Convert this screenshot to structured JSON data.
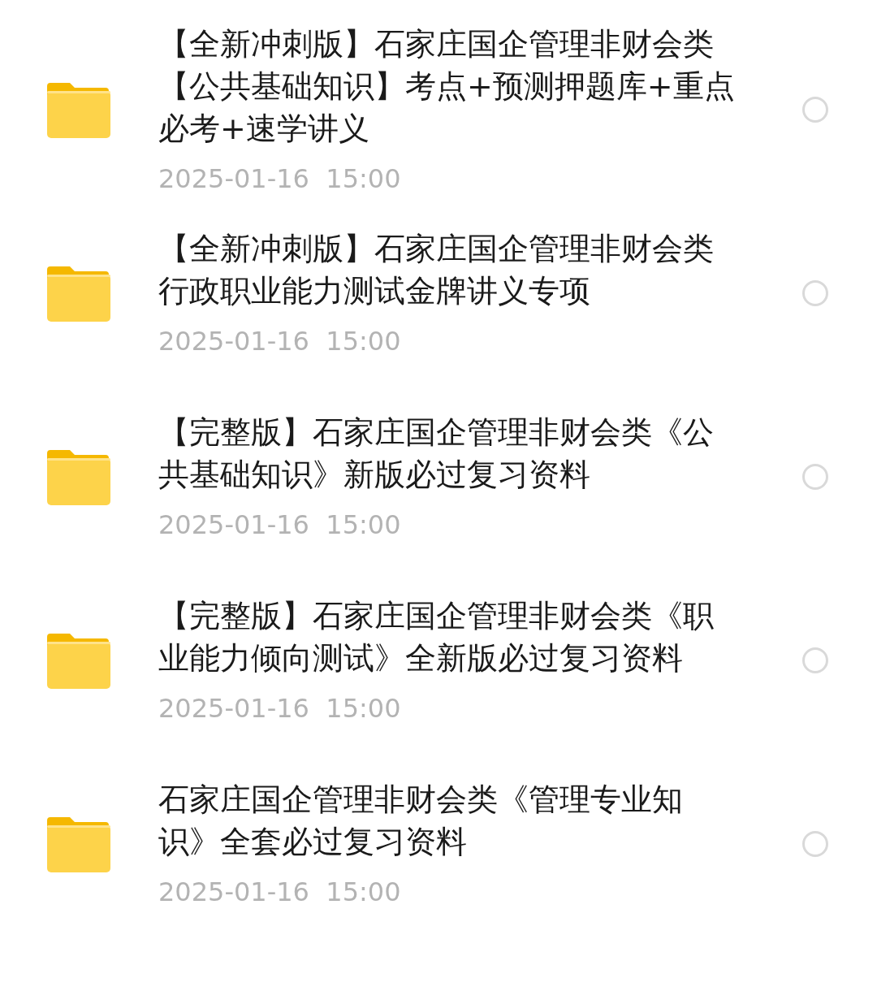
{
  "files": [
    {
      "title": "【全新冲刺版】石家庄国企管理非财会类【公共基础知识】考点+预测押题库+重点必考+速学讲义",
      "date": "2025-01-16  15:00",
      "selected": false
    },
    {
      "title": "【全新冲刺版】石家庄国企管理非财会类行政职业能力测试金牌讲义专项",
      "date": "2025-01-16  15:00",
      "selected": false
    },
    {
      "title": "【完整版】石家庄国企管理非财会类《公共基础知识》新版必过复习资料",
      "date": "2025-01-16  15:00",
      "selected": false
    },
    {
      "title": "【完整版】石家庄国企管理非财会类《职业能力倾向测试》全新版必过复习资料",
      "date": "2025-01-16  15:00",
      "selected": false
    },
    {
      "title": "石家庄国企管理非财会类《管理专业知识》全套必过复习资料",
      "date": "2025-01-16  15:00",
      "selected": false
    }
  ]
}
